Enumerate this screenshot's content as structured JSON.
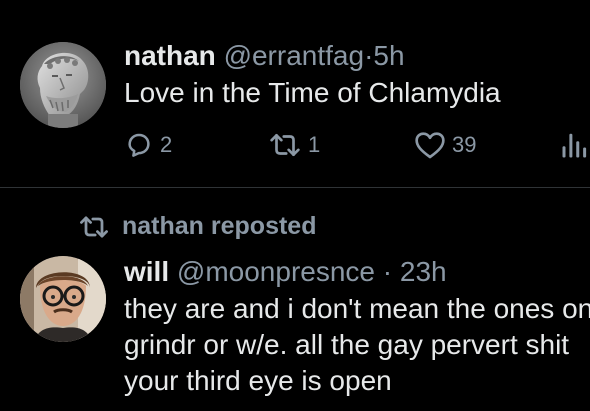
{
  "posts": [
    {
      "author_name": "nathan",
      "handle": "@errantfag",
      "separator": "·",
      "time": "5h",
      "text": "Love in the Time of Chlamydia",
      "avatar_icon": "classical-bust-avatar",
      "actions": {
        "replies": "2",
        "reposts": "1",
        "likes": "39"
      }
    },
    {
      "reposted_by": "nathan reposted",
      "author_name": "will",
      "handle": "@moonpresnce",
      "separator": "·",
      "time": "23h",
      "text_lines": [
        "they are and i don't mean the ones on",
        "grindr or w/e. all the gay pervert shit",
        "your third eye is open"
      ],
      "avatar_icon": "man-with-glasses-avatar"
    }
  ],
  "colors": {
    "background": "#000000",
    "primary_text": "#e7e9ea",
    "secondary_text": "#8b98a5",
    "divider": "#2f3336"
  }
}
